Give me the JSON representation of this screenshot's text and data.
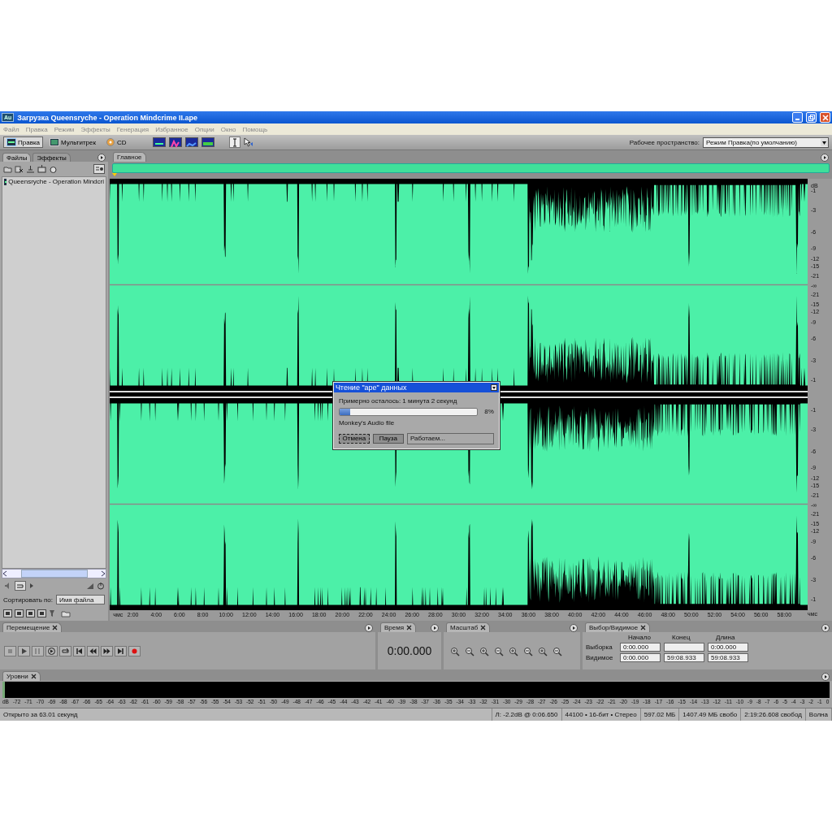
{
  "window": {
    "app_icon": "Au",
    "title": "Загрузка Queensryche - Operation Mindcrime II.ape"
  },
  "menu": [
    "Файл",
    "Правка",
    "Режим",
    "Эффекты",
    "Генерация",
    "Избранное",
    "Опции",
    "Окно",
    "Помощь"
  ],
  "toolbar": {
    "modes": [
      {
        "label": "Правка",
        "selected": true
      },
      {
        "label": "Мультитрек",
        "selected": false
      },
      {
        "label": "CD",
        "selected": false
      }
    ],
    "workspace_label": "Рабочее пространство:",
    "workspace_value": "Режим Правка(по умолчанию)"
  },
  "files_panel": {
    "tabs": [
      {
        "label": "Файлы",
        "selected": true
      },
      {
        "label": "Эффекты",
        "selected": false
      }
    ],
    "files": [
      {
        "name": "Queensryche - Operation Mindcri",
        "selected": false
      }
    ],
    "sort_label": "Сортировать по:",
    "sort_value": "Имя файла"
  },
  "editor": {
    "tab": "Главное",
    "db_unit": "dB",
    "channels": [
      {
        "upper": [
          "-1",
          "-3",
          "-6",
          "-9",
          "-12",
          "-15",
          "-21"
        ],
        "center": "-∞",
        "lower": [
          "-21",
          "-15",
          "-12",
          "-9",
          "-6",
          "-3",
          "-1"
        ]
      },
      {
        "upper": [
          "-1",
          "-3",
          "-6",
          "-9",
          "-12",
          "-15",
          "-21"
        ],
        "center": "-∞",
        "lower": [
          "-21",
          "-15",
          "-12",
          "-9",
          "-6",
          "-3",
          "-1"
        ]
      }
    ],
    "ruler": {
      "start_label": "чмс",
      "end_label": "чмс",
      "ticks": [
        "2:00",
        "4:00",
        "6:00",
        "8:00",
        "10:00",
        "12:00",
        "14:00",
        "16:00",
        "18:00",
        "20:00",
        "22:00",
        "24:00",
        "26:00",
        "28:00",
        "30:00",
        "32:00",
        "34:00",
        "36:00",
        "38:00",
        "40:00",
        "42:00",
        "44:00",
        "46:00",
        "48:00",
        "50:00",
        "52:00",
        "54:00",
        "56:00",
        "58:00"
      ]
    }
  },
  "dialog": {
    "title": "Чтение \"ape\" данных",
    "remaining": "Примерно осталось: 1 минута 2 секунд",
    "level": 0.08,
    "percent": "8%",
    "format": "Monkey's Audio file",
    "buttons": [
      "Отмена",
      "Пауза"
    ],
    "status": "Работаем..."
  },
  "transport": {
    "title": "Перемещение"
  },
  "time": {
    "title": "Время",
    "value": "0:00.000"
  },
  "zoom": {
    "title": "Масштаб"
  },
  "selection": {
    "title": "Выбор/Видимое",
    "columns": [
      "Начало",
      "Конец",
      "Длина"
    ],
    "rows": [
      {
        "label": "Выборка",
        "start": "0:00.000",
        "length": "0:00.000"
      },
      {
        "label": "Видимое",
        "start": "0:00.000",
        "end": "59:08.933",
        "length": "59:08.933"
      }
    ]
  },
  "levels": {
    "title": "Уровни",
    "scale": [
      "dB",
      "-72",
      "-71",
      "-70",
      "-69",
      "-68",
      "-67",
      "-66",
      "-65",
      "-64",
      "-63",
      "-62",
      "-61",
      "-60",
      "-59",
      "-58",
      "-57",
      "-56",
      "-55",
      "-54",
      "-53",
      "-52",
      "-51",
      "-50",
      "-49",
      "-48",
      "-47",
      "-46",
      "-45",
      "-44",
      "-43",
      "-42",
      "-41",
      "-40",
      "-39",
      "-38",
      "-37",
      "-36",
      "-35",
      "-34",
      "-33",
      "-32",
      "-31",
      "-30",
      "-29",
      "-28",
      "-27",
      "-26",
      "-25",
      "-24",
      "-23",
      "-22",
      "-21",
      "-20",
      "-19",
      "-18",
      "-17",
      "-16",
      "-15",
      "-14",
      "-13",
      "-12",
      "-11",
      "-10",
      "-9",
      "-8",
      "-7",
      "-6",
      "-5",
      "-4",
      "-3",
      "-2",
      "-1",
      "0"
    ]
  },
  "status_bar": [
    "Открыто за 63.01 секунд",
    "Л: -2.2dB @  0:06.650",
    "44100 • 16-бит • Стерео",
    "597.02 МБ",
    "1407.49 МБ свобо",
    "2:19:26.608 свобод",
    "Волна"
  ]
}
